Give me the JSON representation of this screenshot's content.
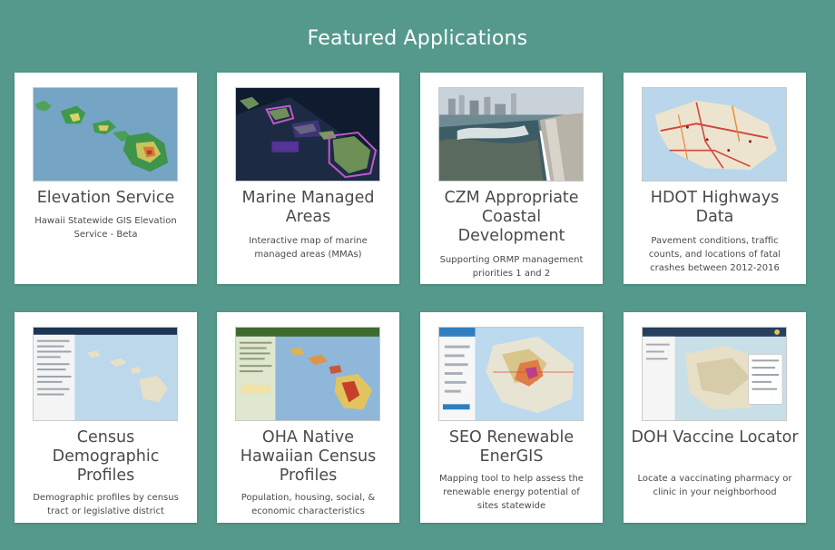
{
  "header": {
    "title": "Featured Applications"
  },
  "cards": [
    {
      "title": "Elevation Service",
      "description": "Hawaii Statewide GIS Elevation Service - Beta",
      "thumbnail": "elevation-map-image"
    },
    {
      "title": "Marine Managed Areas",
      "description": "Interactive map of marine managed areas (MMAs)",
      "thumbnail": "marine-map-image"
    },
    {
      "title": "CZM Appropriate Coastal Development",
      "description": "Supporting ORMP management priorities 1 and 2",
      "thumbnail": "coastline-photo"
    },
    {
      "title": "HDOT Highways Data",
      "description": "Pavement conditions, traffic counts, and locations of fatal crashes between 2012-2016",
      "thumbnail": "highways-map-image"
    },
    {
      "title": "Census Demographic Profiles",
      "description": "Demographic profiles by census tract or legislative district",
      "thumbnail": "census-map-image"
    },
    {
      "title": "OHA Native Hawaiian Census Profiles",
      "description": "Population, housing, social, & economic characteristics",
      "thumbnail": "oha-map-image"
    },
    {
      "title": "SEO Renewable EnerGIS",
      "description": "Mapping tool to help assess the renewable energy potential of sites statewide",
      "thumbnail": "energis-map-image"
    },
    {
      "title": "DOH Vaccine Locator",
      "description": "Locate a vaccinating pharmacy or clinic in your neighborhood",
      "thumbnail": "vaccine-map-image"
    }
  ],
  "colors": {
    "background": "#55998c",
    "card": "#ffffff",
    "text": "#4a4a4a"
  }
}
